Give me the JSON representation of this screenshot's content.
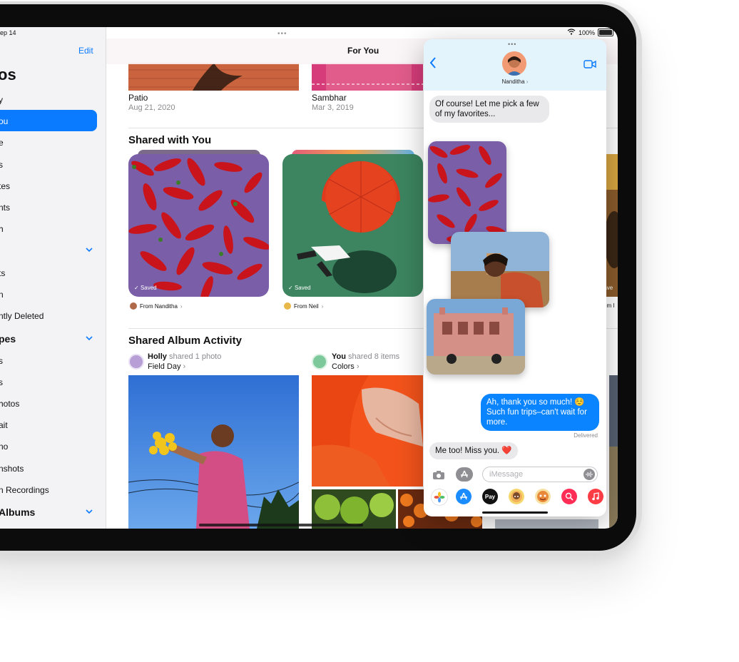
{
  "status_bar": {
    "time": "ep 14",
    "battery": "100%"
  },
  "sidebar": {
    "edit": "Edit",
    "title": "os",
    "items": [
      "y",
      "ou",
      "e",
      "s",
      "tes",
      "nts",
      "h"
    ],
    "utilities": [
      "ts",
      "n",
      "ntly Deleted"
    ],
    "media_types_header": "pes",
    "media_types": [
      "s",
      "s",
      "hotos",
      "ait",
      "no",
      "nshots",
      "n Recordings"
    ],
    "albums_header": "Albums"
  },
  "main": {
    "nav_title": "For You",
    "memories": [
      {
        "title": "Patio",
        "date": "Aug 21, 2020"
      },
      {
        "title": "Sambhar",
        "date": "Mar 3, 2019"
      }
    ],
    "shared_with_you_title": "Shared with You",
    "shared_cards": [
      {
        "saved": "Saved",
        "from": "From Nanditha"
      },
      {
        "saved": "Saved",
        "from": "From Neil"
      }
    ],
    "side_card_saved": "Save",
    "side_card_from": "om I",
    "shared_album_activity_title": "Shared Album Activity",
    "activity": [
      {
        "name": "Holly",
        "action": "shared 1 photo",
        "album": "Field Day"
      },
      {
        "name": "You",
        "action": "shared 8 items",
        "album": "Colors"
      }
    ]
  },
  "messages": {
    "contact_name": "Nanditha",
    "incoming_1": "Of course! Let me pick a few of my favorites...",
    "outgoing_1": "Ah, thank you so much! ☺️ Such fun trips–can't wait for more.",
    "delivered": "Delivered",
    "incoming_2": "Me too! Miss you. ❤️",
    "input_placeholder": "iMessage",
    "apple_pay": "Pay"
  },
  "colors": {
    "accent": "#0a7aff",
    "bubble_out": "#0a84ff",
    "bubble_in": "#e9e9eb"
  }
}
